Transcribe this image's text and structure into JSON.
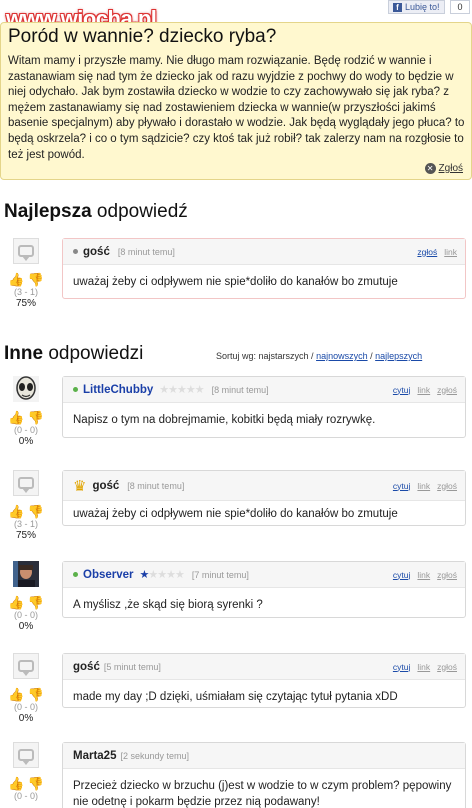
{
  "watermark": "www.wiocha.pl",
  "facebook": {
    "like_label": "Lubię to!",
    "logo": "f",
    "count": "0"
  },
  "question": {
    "title": "Poród w wannie? dziecko ryba?",
    "body": "Witam mamy i przyszłe mamy. Nie długo mam rozwiązanie. Będę rodzić w wannie i zastanawiam się nad tym że dziecko jak od razu wyjdzie z pochwy do wody to będzie w niej odychało. Jak bym zostawiła dziecko w wodzie to czy zachowywało się jak ryba? z mężem zastanawiamy się nad zostawieniem dziecka w wannie(w przyszłości jakimś basenie specjalnym) aby pływało i dorastało w wodzie. Jak będą wyglądały jego płuca? to będą oskrzela? i co o tym sądzicie? czy ktoś tak już robił? tak zalerzy nam na rozgłosie to też jest powód.",
    "report_label": "Zgłoś"
  },
  "best": {
    "heading_bold": "Najlepsza",
    "heading_rest": " odpowiedź"
  },
  "others": {
    "heading_bold": "Inne",
    "heading_rest": " odpowiedzi"
  },
  "sort": {
    "prefix": "Sortuj wg: najstarszych /",
    "newest": "najnowszych",
    "sep": "/",
    "best": "najlepszych"
  },
  "actions": {
    "quote": "cytuj",
    "link": "link",
    "report": "zgłoś"
  },
  "icons": {
    "thumb_up": "👍",
    "thumb_down": "👎",
    "star": "★",
    "crown": "♛",
    "close": "✕"
  },
  "best_answer": {
    "author": "gość",
    "time": "[8 minut temu]",
    "text": "uważaj żeby ci odpływem nie spie*doliło do kanałów bo zmutuje",
    "score": "(3 - 1)",
    "percent": "75%"
  },
  "answers": [
    {
      "author": "LittleChubby",
      "time": "[8 minut temu]",
      "text": "Napisz o tym na dobrejmamie, kobitki będą miały rozrywkę.",
      "score": "(0 - 0)",
      "percent": "0%"
    },
    {
      "author": "gość",
      "time": "[8 minut temu]",
      "text": "uważaj żeby ci odpływem nie spie*doliło do kanałów bo zmutuje",
      "score": "(3 - 1)",
      "percent": "75%"
    },
    {
      "author": "Observer",
      "time": "[7 minut temu]",
      "text": "A myślisz ,że skąd się biorą syrenki ?",
      "score": "(0 - 0)",
      "percent": "0%"
    },
    {
      "author": "gość",
      "time": "[5 minut temu]",
      "text": "made my day ;D dzięki, uśmiałam się czytając tytuł pytania xDD",
      "score": "(0 - 0)",
      "percent": "0%"
    },
    {
      "author": "Marta25",
      "time": "[2 sekundy temu]",
      "text": "Przecież dziecko w brzuchu (j)est w wodzie to w czym problem? pępowiny nie odetnę i pokarm będzie przez nią podawany!",
      "score": "(0 - 0)",
      "percent": ""
    }
  ]
}
